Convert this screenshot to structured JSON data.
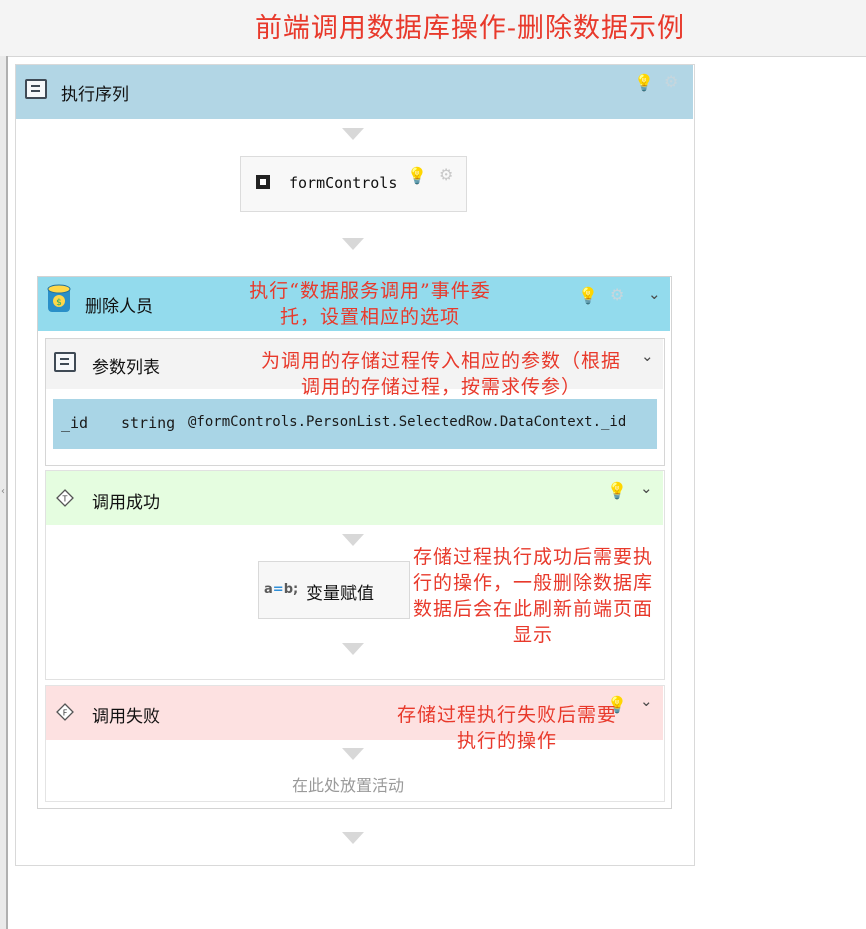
{
  "window": {
    "title": "前端调用数据库操作-删除数据示例"
  },
  "sequence": {
    "label": "执行序列",
    "icon": "sequence-list-icon"
  },
  "form_controls": {
    "label": "formControls"
  },
  "invoke_activity": {
    "label": "删除人员",
    "icon": "database-service-icon",
    "parameters": {
      "label": "参数列表",
      "rows": [
        {
          "name": "_id",
          "type": "string",
          "value": "@formControls.PersonList.SelectedRow.DataContext._id"
        }
      ]
    },
    "on_success": {
      "label": "调用成功",
      "badge": "T",
      "activity": {
        "icon_text": "a=b;",
        "icon_left": "a",
        "icon_eq": "=",
        "icon_right": "b;",
        "label": "变量赋值"
      }
    },
    "on_failure": {
      "label": "调用失败",
      "badge": "F",
      "placeholder": "在此处放置活动"
    }
  },
  "annotations": {
    "invoke": [
      "执行“数据服务调用”事件委",
      "托，设置相应的选项"
    ],
    "params": [
      "为调用的存储过程传入相应的参数（根据",
      "调用的存储过程，按需求传参）"
    ],
    "success": [
      "存储过程执行成功后需要执",
      "行的操作，一般删除数据库",
      "数据后会在此刷新前端页面",
      "显示"
    ],
    "failure": [
      "存储过程执行失败后需要",
      "执行的操作"
    ]
  },
  "colors": {
    "annotation_red": "#e8392b",
    "sequence_header": "#b2d6e5",
    "invoke_header": "#93dbed",
    "param_row": "#a9d5e6",
    "success_header": "#e5fde0",
    "failure_header": "#fde1e1"
  }
}
